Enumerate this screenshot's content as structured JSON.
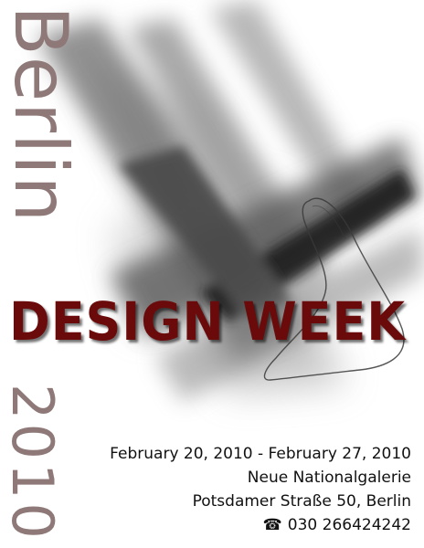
{
  "poster": {
    "city": "Berlin",
    "year": "2010",
    "headline": "DESIGN WEEK",
    "dates": "February 20, 2010 - February 27, 2010",
    "venue": "Neue Nationalgalerie",
    "address": "Potsdamer Straße 50, Berlin",
    "phone": "030 266424242",
    "phone_icon": "telephone-icon"
  },
  "colors": {
    "city_year": "#8f7878",
    "headline": "#6b0a0a",
    "text": "#111111",
    "background": "#ffffff"
  }
}
